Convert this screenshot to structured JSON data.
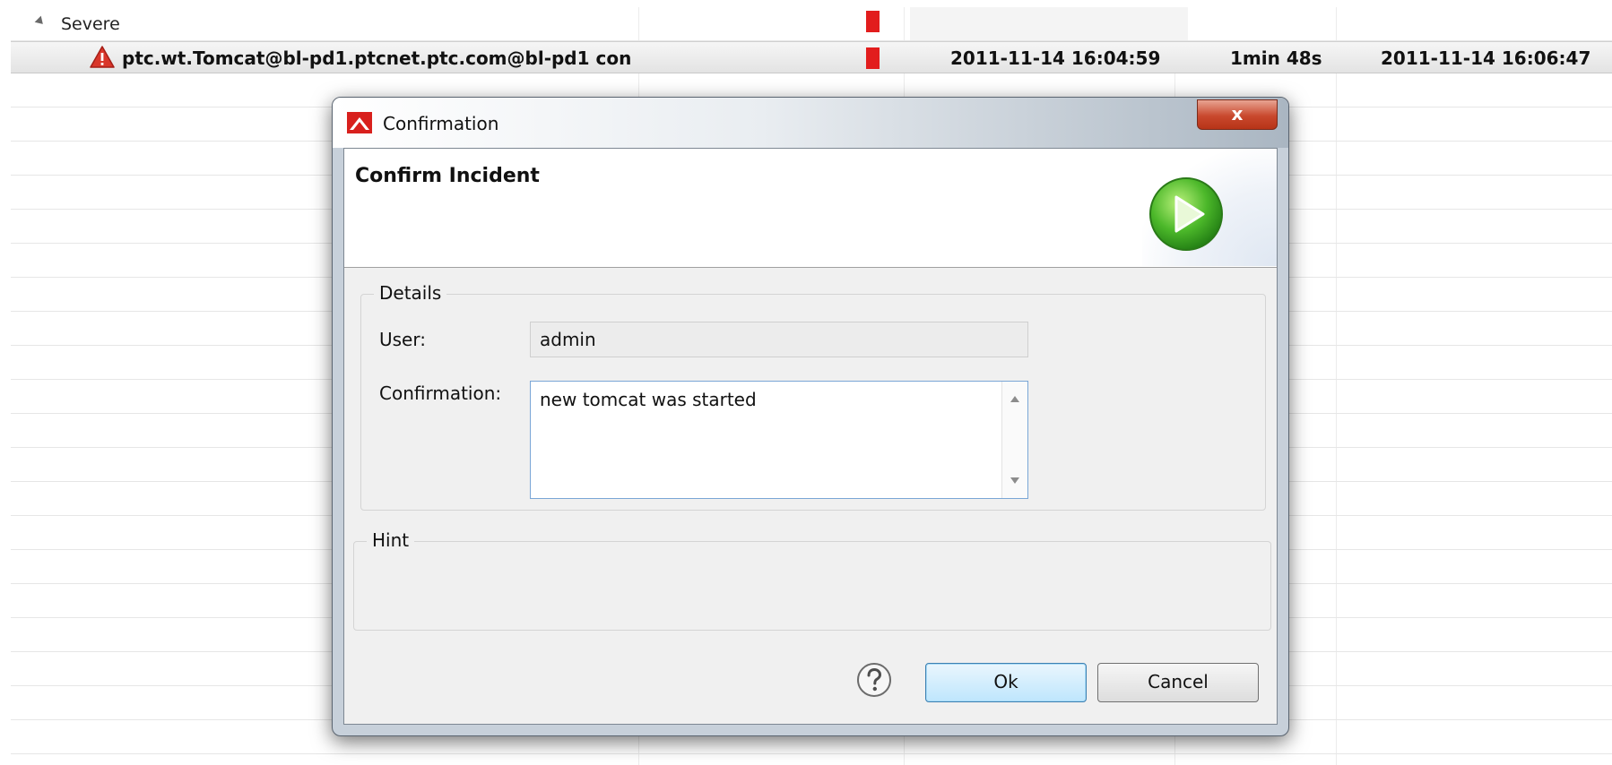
{
  "table": {
    "group_label": "Severe",
    "selected_row": {
      "name": "ptc.wt.Tomcat@bl-pd1.ptcnet.ptc.com@bl-pd1 con",
      "start_time": "2011-11-14 16:04:59",
      "duration": "1min 48s",
      "end_time": "2011-11-14 16:06:47"
    },
    "severity_color": "#e21d1d"
  },
  "dialog": {
    "title": "Confirmation",
    "close_glyph": "x",
    "header_title": "Confirm Incident",
    "details": {
      "legend": "Details",
      "user_label": "User:",
      "user_value": "admin",
      "confirmation_label": "Confirmation:",
      "confirmation_value": "new tomcat was started"
    },
    "hint": {
      "legend": "Hint"
    },
    "buttons": {
      "ok": "Ok",
      "cancel": "Cancel",
      "help_icon": "help-icon"
    }
  }
}
